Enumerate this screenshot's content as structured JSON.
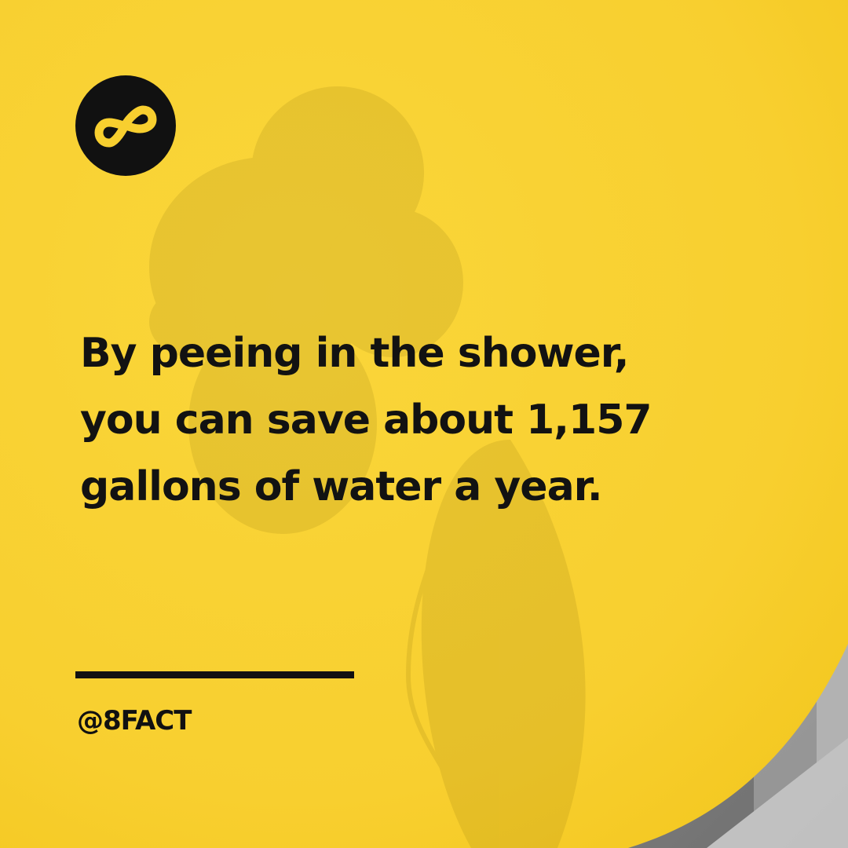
{
  "post": {
    "headline_lines": [
      "By peeing in the shower,",
      "you can save about 1,157",
      "gallons of water a year."
    ],
    "handle": "@8FACT"
  },
  "brand": {
    "logo_icon": "infinity-eight-icon",
    "accent_color": "#F8CF2F",
    "text_color": "#121212",
    "background_image": "dog-in-shower-photo"
  }
}
